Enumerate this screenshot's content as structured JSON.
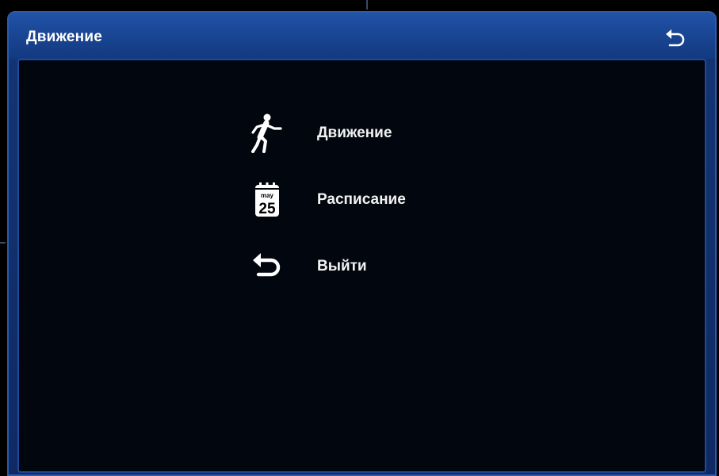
{
  "window": {
    "title": "Движение",
    "back_icon": "return-arrow-icon"
  },
  "menu": {
    "items": [
      {
        "label": "Движение",
        "icon": "walking-person-icon"
      },
      {
        "label": "Расписание",
        "icon": "calendar-icon",
        "calendar_month": "may",
        "calendar_day": "25"
      },
      {
        "label": "Выйти",
        "icon": "return-arrow-icon"
      }
    ]
  },
  "colors": {
    "title_bar": "#1a4695",
    "window_border": "#2e5aa8",
    "content_background": "#02060e",
    "text": "#ffffff"
  }
}
